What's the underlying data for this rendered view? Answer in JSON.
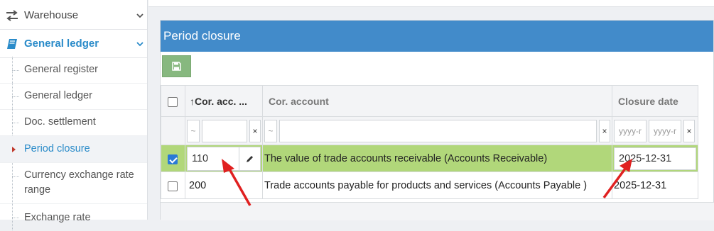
{
  "sidebar": {
    "warehouse_label": "Warehouse",
    "general_ledger_label": "General ledger",
    "items": [
      {
        "label": "General register"
      },
      {
        "label": "General ledger"
      },
      {
        "label": "Doc. settlement"
      },
      {
        "label": "Period closure"
      },
      {
        "label": "Currency exchange rate range"
      },
      {
        "label": "Exchange rate"
      }
    ]
  },
  "panel": {
    "title": "Period closure",
    "columns": {
      "cor_acc_code": "Cor. acc. ...",
      "cor_account": "Cor. account",
      "closure_date": "Closure date"
    },
    "filters": {
      "tilde": "~",
      "clear": "×",
      "date_from_placeholder": "yyyy-r",
      "date_to_placeholder": "yyyy-r"
    },
    "rows": [
      {
        "code": "110",
        "account": "The value of trade accounts receivable (Accounts Receivable)",
        "date": "2025-12-31",
        "selected": true
      },
      {
        "code": "200",
        "account": "Trade accounts payable for products and services (Accounts Payable )",
        "date": "2025-12-31",
        "selected": false
      }
    ]
  },
  "colors": {
    "header_blue": "#428bca",
    "selected_row": "#b1d77a",
    "save_button": "#87b87f",
    "annotation_arrow": "#e02020"
  }
}
